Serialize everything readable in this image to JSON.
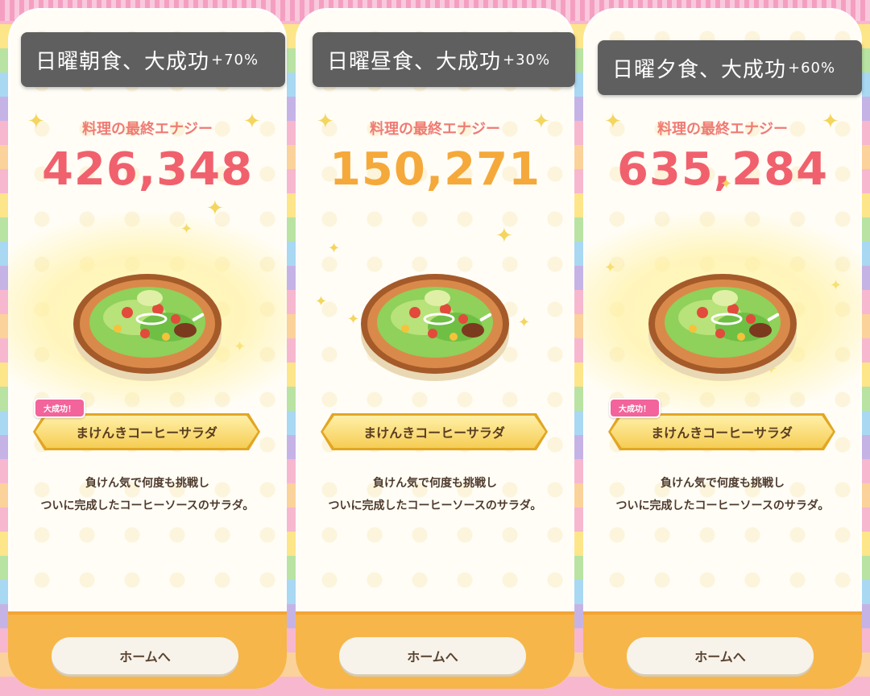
{
  "panels": [
    {
      "banner_main": "日曜朝食、大成功",
      "banner_bonus": "+70%",
      "energy_label": "料理の最終エナジー",
      "energy_value": "426,348",
      "energy_color": "#f0616d",
      "badge": "大成功！",
      "dish_name": "まけんきコーヒーサラダ",
      "desc_line1": "負けん気で何度も挑戦し",
      "desc_line2": "ついに完成したコーヒーソースのサラダ。",
      "home_button": "ホームへ"
    },
    {
      "banner_main": "日曜昼食、大成功",
      "banner_bonus": "+30%",
      "energy_label": "料理の最終エナジー",
      "energy_value": "150,271",
      "energy_color": "#f5a93a",
      "dish_name": "まけんきコーヒーサラダ",
      "desc_line1": "負けん気で何度も挑戦し",
      "desc_line2": "ついに完成したコーヒーソースのサラダ。",
      "home_button": "ホームへ"
    },
    {
      "banner_main": "日曜夕食、大成功",
      "banner_bonus": "+60%",
      "energy_label": "料理の最終エナジー",
      "energy_value": "635,284",
      "energy_color": "#f0616d",
      "badge": "大成功！",
      "dish_name": "まけんきコーヒーサラダ",
      "desc_line1": "負けん気で何度も挑戦し",
      "desc_line2": "ついに完成したコーヒーソースのサラダ。",
      "home_button": "ホームへ"
    }
  ],
  "icons": {
    "sparkle": "sparkle-icon",
    "dish": "salad-dish-icon"
  }
}
